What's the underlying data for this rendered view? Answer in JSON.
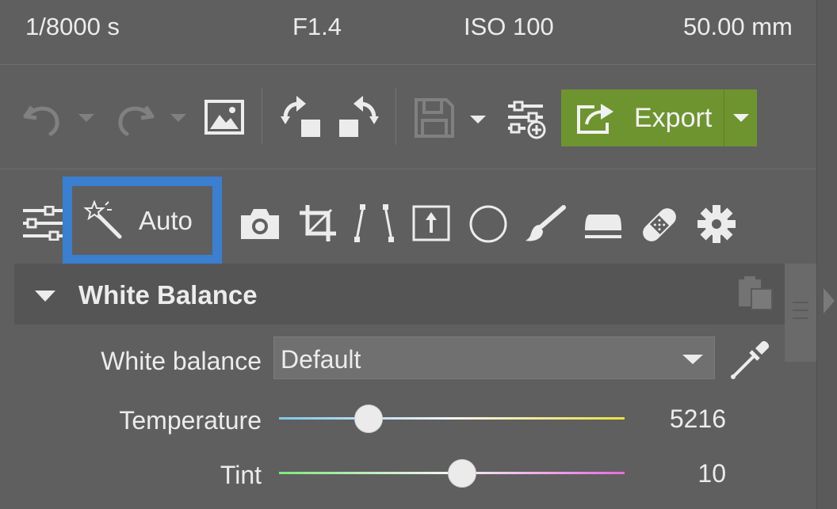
{
  "exif": {
    "shutter": "1/8000 s",
    "aperture": "F1.4",
    "iso": "ISO 100",
    "focal": "50.00 mm"
  },
  "toolbar": {
    "export_label": "Export"
  },
  "tools": {
    "auto_label": "Auto"
  },
  "panel": {
    "title": "White Balance",
    "white_balance": {
      "label": "White balance",
      "selected": "Default"
    },
    "temperature": {
      "label": "Temperature",
      "value": "5216",
      "position_fraction": 0.26
    },
    "tint": {
      "label": "Tint",
      "value": "10",
      "position_fraction": 0.53
    }
  },
  "colors": {
    "background": "#5f5f5f",
    "export_green": "#6e9430",
    "auto_highlight": "#3a7fd0",
    "temperature_gradient": [
      "#7ec8e8",
      "#f4f4f4",
      "#e8e040"
    ],
    "tint_gradient": [
      "#7ee87e",
      "#f4f4f4",
      "#e86ae0"
    ]
  },
  "icons": [
    "undo-icon",
    "redo-icon",
    "image-icon",
    "rotate-left-icon",
    "rotate-right-icon",
    "save-icon",
    "add-preset-icon",
    "export-icon",
    "sliders-icon",
    "magic-wand-icon",
    "camera-icon",
    "crop-icon",
    "perspective-icon",
    "frame-icon",
    "circle-icon",
    "brush-icon",
    "iron-icon",
    "bandage-icon",
    "gear-icon",
    "paste-icon",
    "eyedropper-icon"
  ]
}
